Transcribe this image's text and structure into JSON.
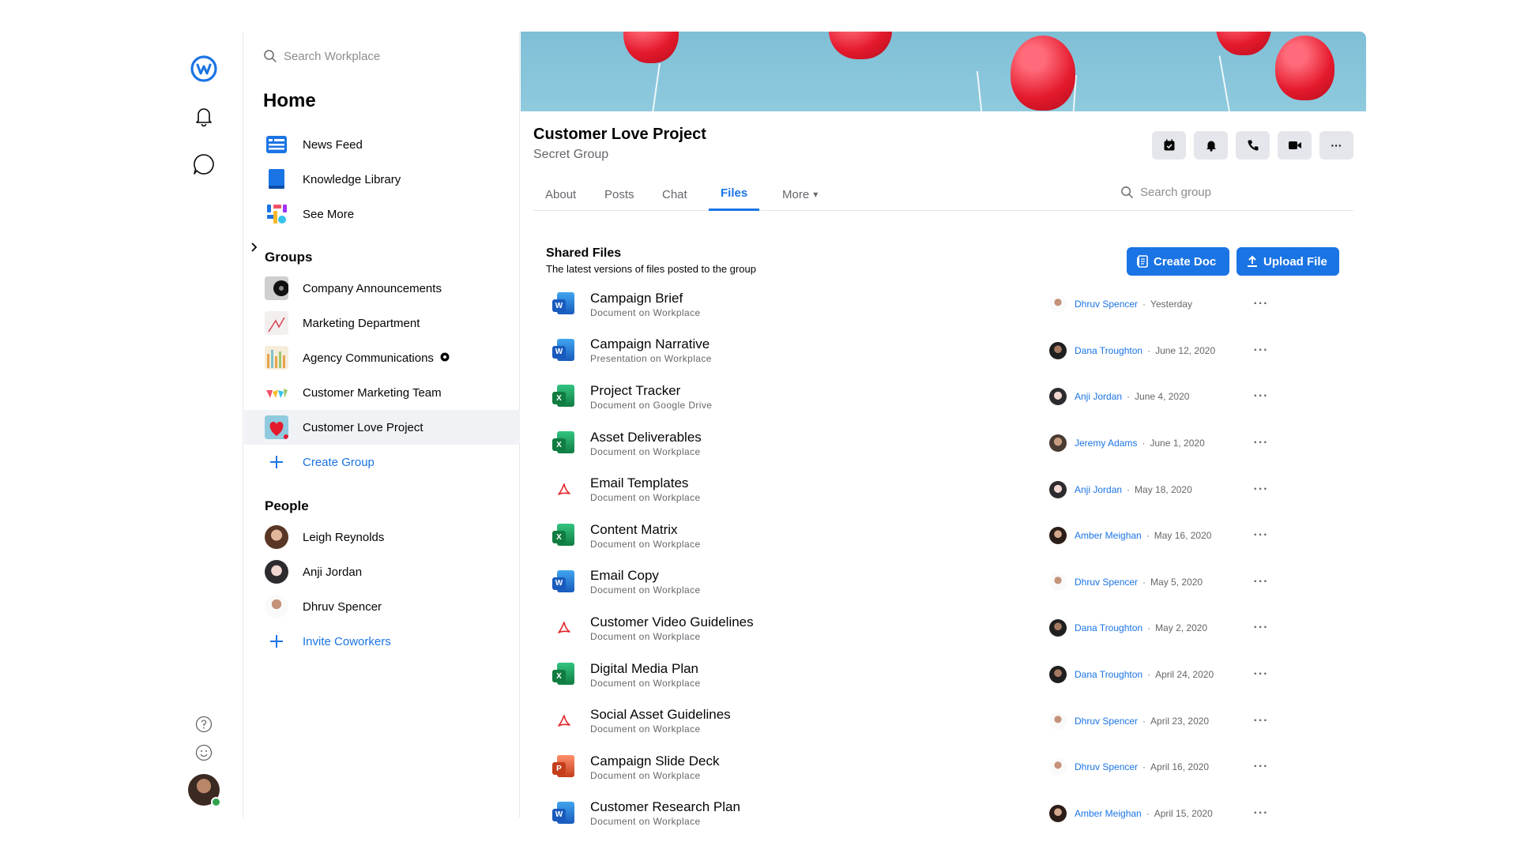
{
  "search": {
    "placeholder": "Search Workplace"
  },
  "nav": {
    "title": "Home",
    "items": [
      {
        "label": "News Feed"
      },
      {
        "label": "Knowledge Library"
      },
      {
        "label": "See More"
      }
    ],
    "groups_title": "Groups",
    "groups": [
      {
        "label": "Company Announcements"
      },
      {
        "label": "Marketing Department"
      },
      {
        "label": "Agency Communications"
      },
      {
        "label": "Customer Marketing Team"
      },
      {
        "label": "Customer Love Project"
      }
    ],
    "create_group": "Create Group",
    "people_title": "People",
    "people": [
      {
        "label": "Leigh Reynolds"
      },
      {
        "label": "Anji Jordan"
      },
      {
        "label": "Dhruv Spencer"
      }
    ],
    "invite": "Invite Coworkers"
  },
  "group": {
    "title": "Customer Love Project",
    "subtitle": "Secret Group",
    "tabs": [
      "About",
      "Posts",
      "Chat",
      "Files",
      "More"
    ],
    "active_tab": "Files",
    "search_placeholder": "Search group"
  },
  "files": {
    "title": "Shared Files",
    "subtitle": "The latest versions of files posted to the group",
    "create_doc": "Create Doc",
    "upload_file": "Upload File",
    "rows": [
      {
        "name": "Campaign Brief",
        "source": "Document on Workplace",
        "type": "word",
        "user": "Dhruv Spencer",
        "date": "Yesterday"
      },
      {
        "name": "Campaign Narrative",
        "source": "Presentation on Workplace",
        "type": "word",
        "user": "Dana Troughton",
        "date": "June 12, 2020"
      },
      {
        "name": "Project Tracker",
        "source": "Document on Google Drive",
        "type": "excel",
        "user": "Anji Jordan",
        "date": "June 4, 2020"
      },
      {
        "name": "Asset Deliverables",
        "source": "Document on Workplace",
        "type": "excel",
        "user": "Jeremy Adams",
        "date": "June 1, 2020"
      },
      {
        "name": "Email Templates",
        "source": "Document on Workplace",
        "type": "pdf",
        "user": "Anji Jordan",
        "date": "May 18, 2020"
      },
      {
        "name": "Content Matrix",
        "source": "Document on Workplace",
        "type": "excel",
        "user": "Amber Meighan",
        "date": "May 16, 2020"
      },
      {
        "name": "Email Copy",
        "source": "Document on Workplace",
        "type": "word",
        "user": "Dhruv Spencer",
        "date": "May 5, 2020"
      },
      {
        "name": "Customer Video Guidelines",
        "source": "Document on Workplace",
        "type": "pdf",
        "user": "Dana Troughton",
        "date": "May 2, 2020"
      },
      {
        "name": "Digital Media Plan",
        "source": "Document on Workplace",
        "type": "excel",
        "user": "Dana Troughton",
        "date": "April 24, 2020"
      },
      {
        "name": "Social Asset Guidelines",
        "source": "Document on Workplace",
        "type": "pdf",
        "user": "Dhruv Spencer",
        "date": "April 23, 2020"
      },
      {
        "name": "Campaign Slide Deck",
        "source": "Document on Workplace",
        "type": "ppt",
        "user": "Dhruv Spencer",
        "date": "April 16, 2020"
      },
      {
        "name": "Customer Research Plan",
        "source": "Document on Workplace",
        "type": "word",
        "user": "Amber Meighan",
        "date": "April 15, 2020"
      }
    ]
  },
  "colors": {
    "accent": "#1b74e4",
    "word": "#185abd",
    "excel": "#107c41",
    "ppt": "#c43e1c",
    "pdf": "#e0242a"
  },
  "icons": {
    "word_letter": "W",
    "excel_letter": "X",
    "ppt_letter": "P",
    "more": "···",
    "chevron": "▾"
  }
}
